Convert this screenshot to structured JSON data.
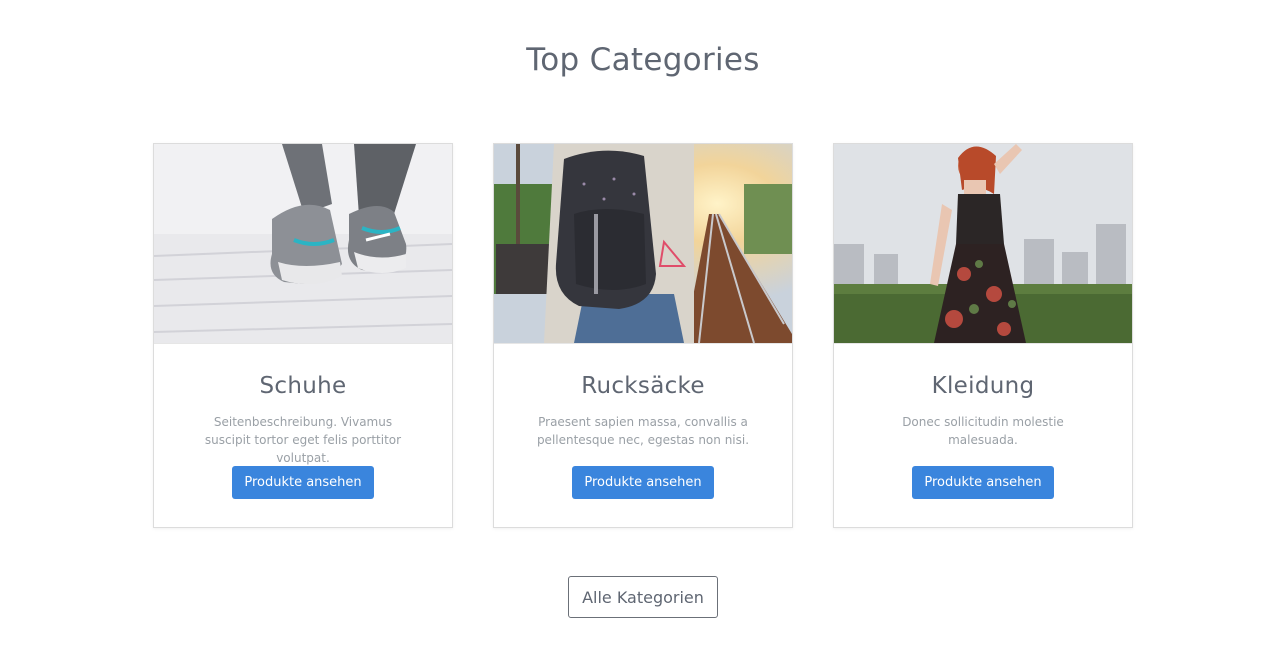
{
  "section": {
    "title": "Top Categories"
  },
  "categories": [
    {
      "title": "Schuhe",
      "description": "Seitenbeschreibung. Vivamus suscipit tortor eget felis porttitor volutpat.",
      "button_label": "Produkte ansehen",
      "image_icon": "sneakers-photo"
    },
    {
      "title": "Rucksäcke",
      "description": "Praesent sapien massa, convallis a pellentesque nec, egestas non nisi.",
      "button_label": "Produkte ansehen",
      "image_icon": "backpack-photo"
    },
    {
      "title": "Kleidung",
      "description": "Donec sollicitudin molestie malesuada.",
      "button_label": "Produkte ansehen",
      "image_icon": "dress-photo"
    }
  ],
  "footer": {
    "all_label": "Alle Kategorien"
  },
  "colors": {
    "primary_button": "#3a85dd",
    "title_text": "#5f6672",
    "muted_text": "#9aa0a6"
  }
}
